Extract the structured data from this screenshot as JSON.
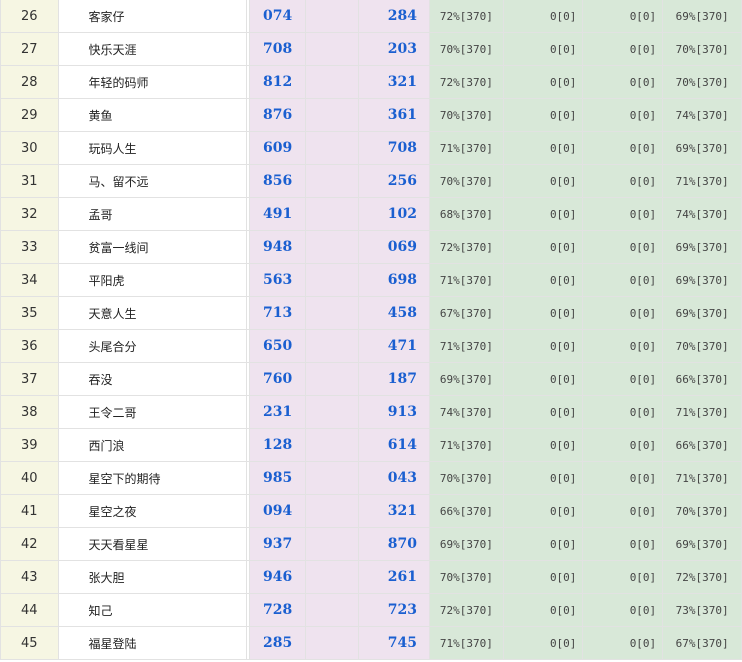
{
  "rows": [
    {
      "rank": "26",
      "name": "客家仔",
      "num1": "074",
      "num2": "284",
      "s1": "72%[370]",
      "s2": "0[0]",
      "s3": "0[0]",
      "s4": "69%[370]"
    },
    {
      "rank": "27",
      "name": "快乐天涯",
      "num1": "708",
      "num2": "203",
      "s1": "70%[370]",
      "s2": "0[0]",
      "s3": "0[0]",
      "s4": "70%[370]"
    },
    {
      "rank": "28",
      "name": "年轻的码师",
      "num1": "812",
      "num2": "321",
      "s1": "72%[370]",
      "s2": "0[0]",
      "s3": "0[0]",
      "s4": "70%[370]"
    },
    {
      "rank": "29",
      "name": "黄鱼",
      "num1": "876",
      "num2": "361",
      "s1": "70%[370]",
      "s2": "0[0]",
      "s3": "0[0]",
      "s4": "74%[370]"
    },
    {
      "rank": "30",
      "name": "玩码人生",
      "num1": "609",
      "num2": "708",
      "s1": "71%[370]",
      "s2": "0[0]",
      "s3": "0[0]",
      "s4": "69%[370]"
    },
    {
      "rank": "31",
      "name": "马、留不远",
      "num1": "856",
      "num2": "256",
      "s1": "70%[370]",
      "s2": "0[0]",
      "s3": "0[0]",
      "s4": "71%[370]"
    },
    {
      "rank": "32",
      "name": "孟哥",
      "num1": "491",
      "num2": "102",
      "s1": "68%[370]",
      "s2": "0[0]",
      "s3": "0[0]",
      "s4": "74%[370]"
    },
    {
      "rank": "33",
      "name": "贫富一线间",
      "num1": "948",
      "num2": "069",
      "s1": "72%[370]",
      "s2": "0[0]",
      "s3": "0[0]",
      "s4": "69%[370]"
    },
    {
      "rank": "34",
      "name": "平阳虎",
      "num1": "563",
      "num2": "698",
      "s1": "71%[370]",
      "s2": "0[0]",
      "s3": "0[0]",
      "s4": "69%[370]"
    },
    {
      "rank": "35",
      "name": "天意人生",
      "num1": "713",
      "num2": "458",
      "s1": "67%[370]",
      "s2": "0[0]",
      "s3": "0[0]",
      "s4": "69%[370]"
    },
    {
      "rank": "36",
      "name": "头尾合分",
      "num1": "650",
      "num2": "471",
      "s1": "71%[370]",
      "s2": "0[0]",
      "s3": "0[0]",
      "s4": "70%[370]"
    },
    {
      "rank": "37",
      "name": "吞没",
      "num1": "760",
      "num2": "187",
      "s1": "69%[370]",
      "s2": "0[0]",
      "s3": "0[0]",
      "s4": "66%[370]"
    },
    {
      "rank": "38",
      "name": "王令二哥",
      "num1": "231",
      "num2": "913",
      "s1": "74%[370]",
      "s2": "0[0]",
      "s3": "0[0]",
      "s4": "71%[370]"
    },
    {
      "rank": "39",
      "name": "西门浪",
      "num1": "128",
      "num2": "614",
      "s1": "71%[370]",
      "s2": "0[0]",
      "s3": "0[0]",
      "s4": "66%[370]"
    },
    {
      "rank": "40",
      "name": "星空下的期待",
      "num1": "985",
      "num2": "043",
      "s1": "70%[370]",
      "s2": "0[0]",
      "s3": "0[0]",
      "s4": "71%[370]"
    },
    {
      "rank": "41",
      "name": "星空之夜",
      "num1": "094",
      "num2": "321",
      "s1": "66%[370]",
      "s2": "0[0]",
      "s3": "0[0]",
      "s4": "70%[370]"
    },
    {
      "rank": "42",
      "name": "天天看星星",
      "num1": "937",
      "num2": "870",
      "s1": "69%[370]",
      "s2": "0[0]",
      "s3": "0[0]",
      "s4": "69%[370]"
    },
    {
      "rank": "43",
      "name": "张大胆",
      "num1": "946",
      "num2": "261",
      "s1": "70%[370]",
      "s2": "0[0]",
      "s3": "0[0]",
      "s4": "72%[370]"
    },
    {
      "rank": "44",
      "name": "知己",
      "num1": "728",
      "num2": "723",
      "s1": "72%[370]",
      "s2": "0[0]",
      "s3": "0[0]",
      "s4": "73%[370]"
    },
    {
      "rank": "45",
      "name": "福星登陆",
      "num1": "285",
      "num2": "745",
      "s1": "71%[370]",
      "s2": "0[0]",
      "s3": "0[0]",
      "s4": "67%[370]"
    }
  ]
}
